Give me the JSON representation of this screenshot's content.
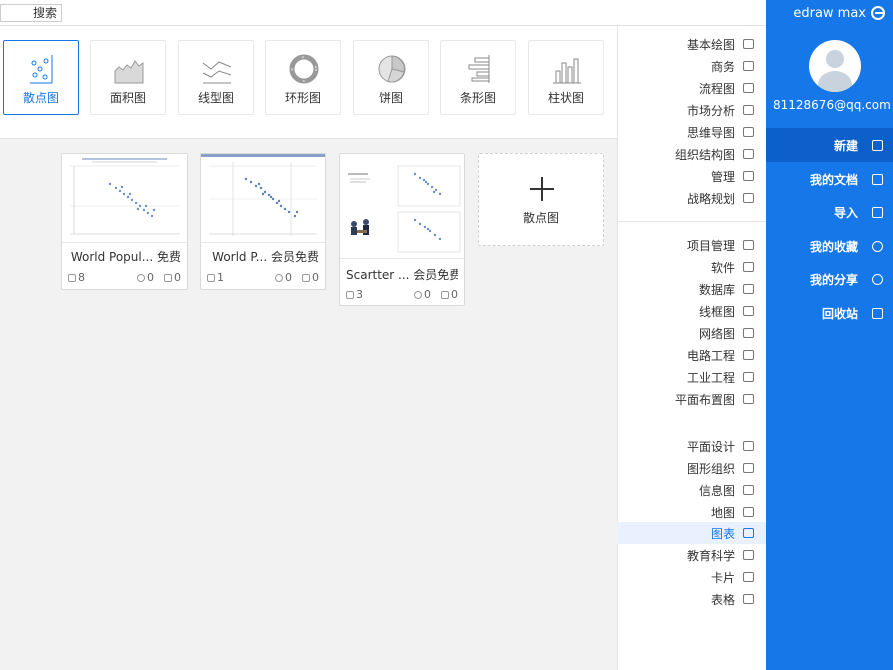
{
  "app": {
    "brand": "edraw max"
  },
  "user": {
    "email": "81128676@qq.com"
  },
  "nav": [
    {
      "label": "新建",
      "icon": "new-doc-icon",
      "active": true
    },
    {
      "label": "我的文档",
      "icon": "documents-icon"
    },
    {
      "label": "导入",
      "icon": "import-icon"
    },
    {
      "label": "我的收藏",
      "icon": "star-icon"
    },
    {
      "label": "我的分享",
      "icon": "share-icon"
    },
    {
      "label": "回收站",
      "icon": "trash-icon"
    }
  ],
  "categories_group1": [
    {
      "label": "基本绘图"
    },
    {
      "label": "商务"
    },
    {
      "label": "流程图"
    },
    {
      "label": "市场分析"
    },
    {
      "label": "思维导图"
    },
    {
      "label": "组织结构图"
    },
    {
      "label": "管理"
    },
    {
      "label": "战略规划"
    }
  ],
  "categories_group2": [
    {
      "label": "项目管理"
    },
    {
      "label": "软件"
    },
    {
      "label": "数据库"
    },
    {
      "label": "线框图"
    },
    {
      "label": "网络图"
    },
    {
      "label": "电路工程"
    },
    {
      "label": "工业工程"
    },
    {
      "label": "平面布置图"
    }
  ],
  "categories_group3": [
    {
      "label": "平面设计"
    },
    {
      "label": "图形组织"
    },
    {
      "label": "信息图"
    },
    {
      "label": "地图"
    },
    {
      "label": "图表",
      "selected": true
    },
    {
      "label": "教育科学"
    },
    {
      "label": "卡片"
    },
    {
      "label": "表格"
    }
  ],
  "search": {
    "label": "搜索"
  },
  "chart_types": [
    {
      "label": "柱状图",
      "icon": "bar-chart-icon"
    },
    {
      "label": "条形图",
      "icon": "horizontal-bar-chart-icon"
    },
    {
      "label": "饼图",
      "icon": "pie-chart-icon"
    },
    {
      "label": "环形图",
      "icon": "donut-chart-icon"
    },
    {
      "label": "线型图",
      "icon": "line-chart-icon"
    },
    {
      "label": "面积图",
      "icon": "area-chart-icon"
    },
    {
      "label": "散点图",
      "icon": "scatter-chart-icon",
      "active": true
    }
  ],
  "new_card": {
    "label": "散点图"
  },
  "templates": [
    {
      "title": "Scartter ... 会员免费",
      "likes": "0",
      "favorites": "0",
      "copies": "3"
    },
    {
      "title": "World P... 会员免费",
      "likes": "0",
      "favorites": "0",
      "copies": "1"
    },
    {
      "title": "World Popul... 免费",
      "likes": "0",
      "favorites": "0",
      "copies": "8"
    }
  ]
}
